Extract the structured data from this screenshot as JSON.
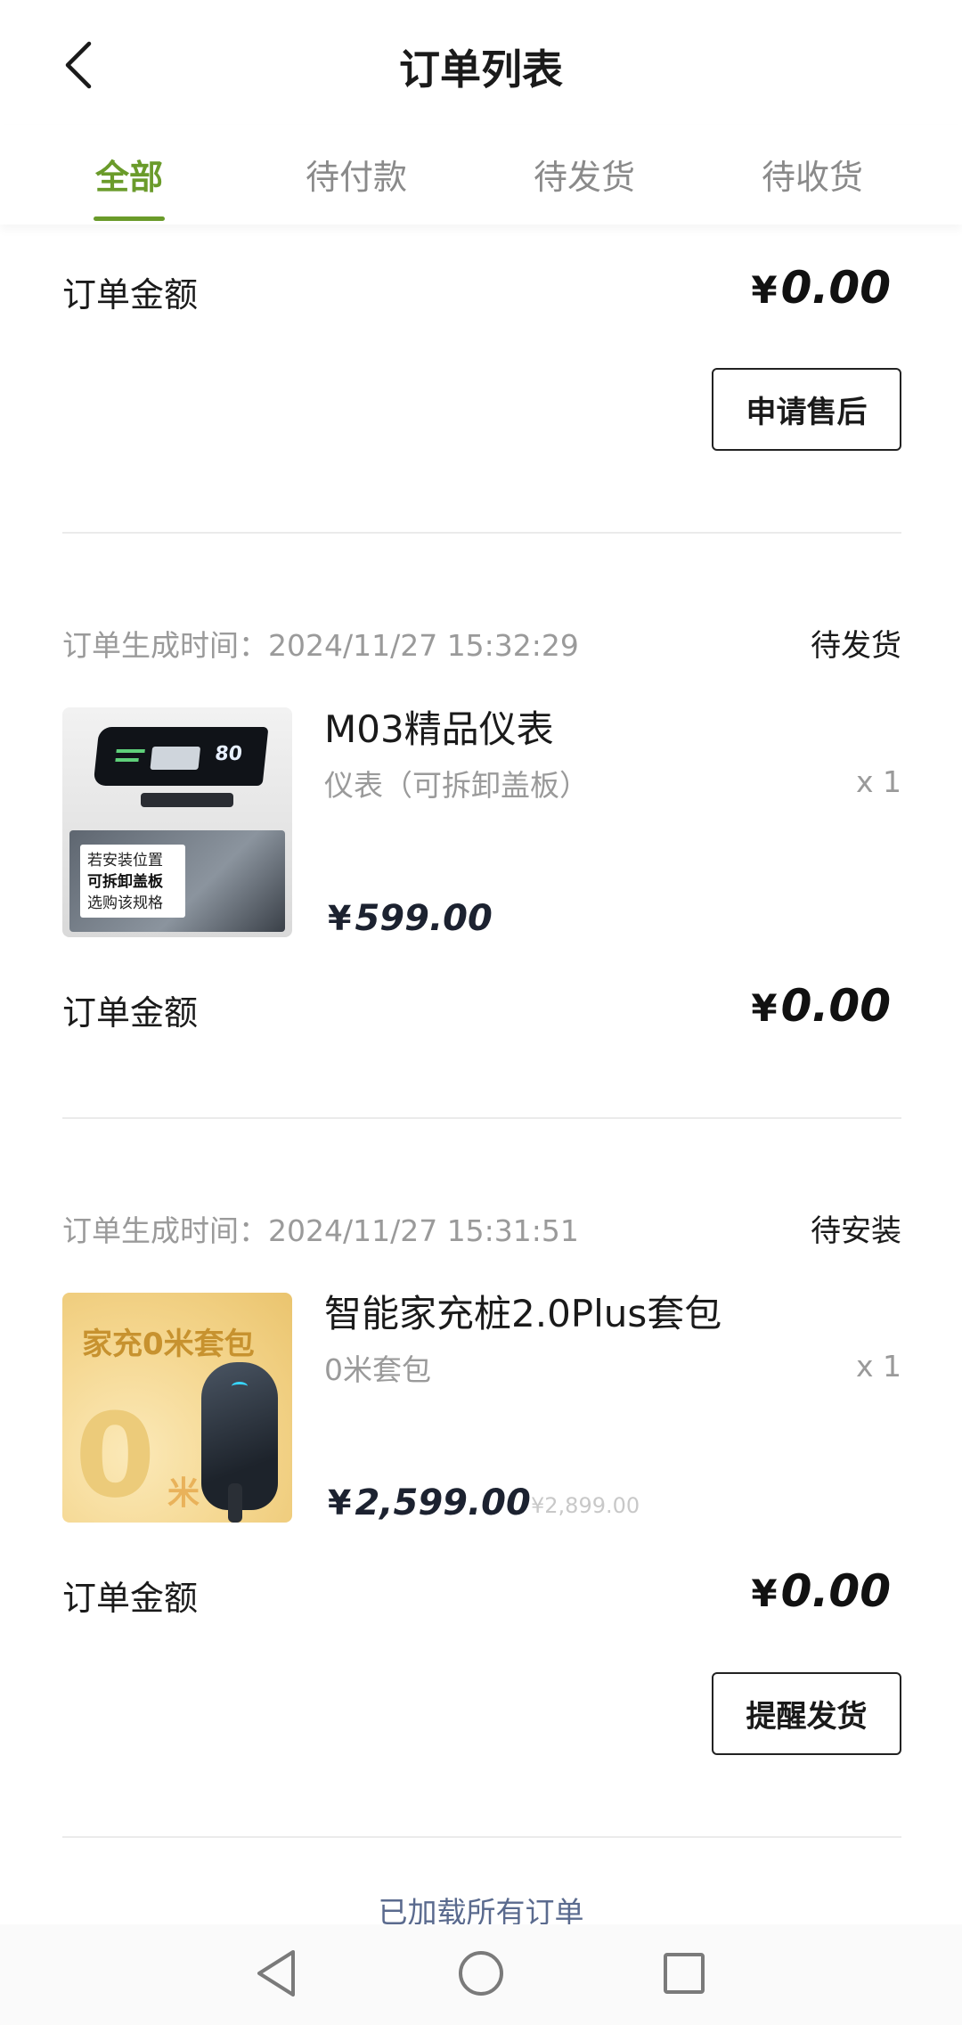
{
  "header": {
    "title": "订单列表",
    "back_icon": "chevron-left-icon"
  },
  "tabs": [
    {
      "label": "全部",
      "active": true
    },
    {
      "label": "待付款",
      "active": false
    },
    {
      "label": "待发货",
      "active": false
    },
    {
      "label": "待收货",
      "active": false
    }
  ],
  "colors": {
    "accent": "#6a9b2a",
    "muted": "#9a9a9a",
    "link": "#5a6a8e"
  },
  "currency": "¥",
  "orders": [
    {
      "total_label": "订单金额",
      "total": "0.00",
      "action": "申请售后"
    },
    {
      "time_label": "订单生成时间：",
      "time": "2024/11/27 15:32:29",
      "status": "待发货",
      "product": {
        "name": "M03精品仪表",
        "spec": "仪表（可拆卸盖板）",
        "qty": "x 1",
        "price": "599.00",
        "image_text": [
          "若安装位置",
          "可拆卸盖板",
          "选购该规格"
        ],
        "screen_value": "80"
      },
      "total_label": "订单金额",
      "total": "0.00"
    },
    {
      "time_label": "订单生成时间：",
      "time": "2024/11/27 15:31:51",
      "status": "待安装",
      "product": {
        "name": "智能家充桩2.0Plus套包",
        "spec": "0米套包",
        "qty": "x 1",
        "price": "2,599.00",
        "original_price": "¥2,899.00",
        "image_text": [
          "家充0米套包",
          "0",
          "米"
        ]
      },
      "total_label": "订单金额",
      "total": "0.00",
      "action": "提醒发货"
    }
  ],
  "footer": {
    "message": "已加载所有订单"
  },
  "navbar": {
    "back_icon": "triangle-back-icon",
    "home_icon": "circle-home-icon",
    "recents_icon": "square-recents-icon"
  }
}
